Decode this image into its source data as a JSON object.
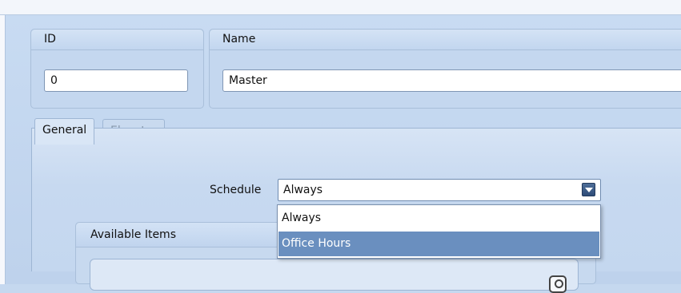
{
  "id_group": {
    "header": "ID",
    "value": "0"
  },
  "name_group": {
    "header": "Name",
    "value": "Master"
  },
  "tabs": [
    {
      "label": "General",
      "active": true
    },
    {
      "label": "Elevator",
      "active": false
    }
  ],
  "schedule": {
    "label": "Schedule",
    "selected": "Always",
    "options": [
      {
        "label": "Always",
        "highlighted": false
      },
      {
        "label": "Office Hours",
        "highlighted": true
      }
    ]
  },
  "available_items": {
    "header": "Available Items"
  },
  "icons": {
    "dropdown_arrow": "chevron-down-icon",
    "search": "search-icon"
  },
  "colors": {
    "background": "#c5d8ef",
    "highlight": "#6a8fbf",
    "arrow_button": "#2e4c78"
  }
}
